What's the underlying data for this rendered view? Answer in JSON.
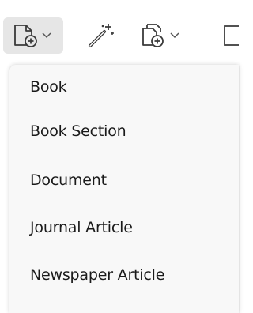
{
  "toolbar": {
    "buttons": [
      {
        "name": "new-item",
        "icon": "new-item-icon",
        "has_dropdown": true,
        "active": true
      },
      {
        "name": "magic-wand",
        "icon": "magic-wand-icon",
        "has_dropdown": false,
        "active": false
      },
      {
        "name": "new-note",
        "icon": "new-note-icon",
        "has_dropdown": true,
        "active": false
      },
      {
        "name": "page",
        "icon": "page-icon",
        "has_dropdown": false,
        "active": false
      }
    ]
  },
  "menu": {
    "items": [
      {
        "label": "Book"
      },
      {
        "label": "Book Section"
      },
      {
        "label": "Document"
      },
      {
        "label": "Journal Article"
      },
      {
        "label": "Newspaper Article"
      }
    ]
  }
}
